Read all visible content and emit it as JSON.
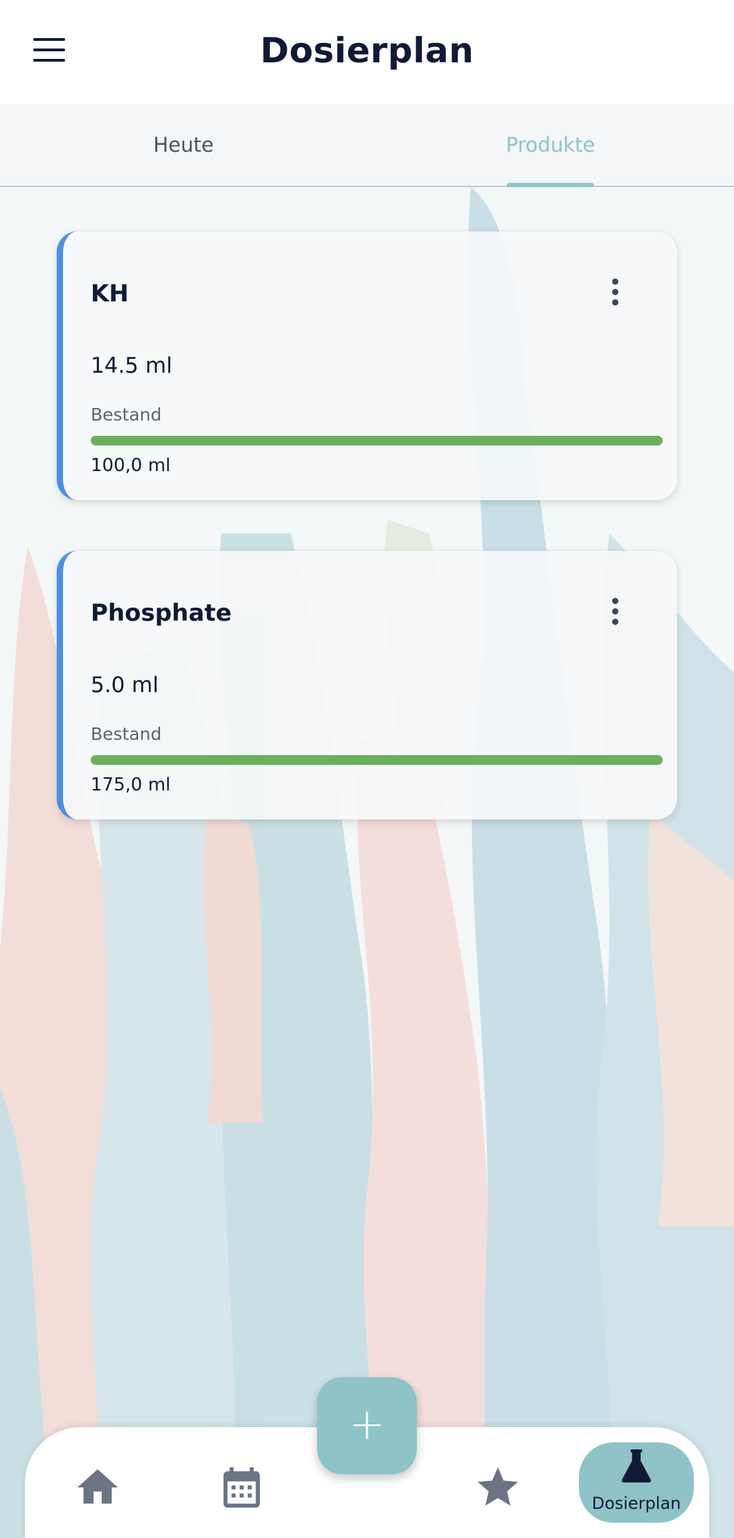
{
  "app_bar": {
    "title": "Dosierplan"
  },
  "tabs": [
    {
      "label": "Heute",
      "active": false
    },
    {
      "label": "Produkte",
      "active": true
    }
  ],
  "products": [
    {
      "name": "KH",
      "dose": "14.5 ml",
      "stock_label": "Bestand",
      "stock_amount": "100,0 ml",
      "stock_fraction": 1.0
    },
    {
      "name": "Phosphate",
      "dose": "5.0 ml",
      "stock_label": "Bestand",
      "stock_amount": "175,0 ml",
      "stock_fraction": 1.0
    }
  ],
  "fab": {
    "label": "+"
  },
  "bottom_nav": {
    "items": [
      {
        "icon": "home-icon",
        "label": ""
      },
      {
        "icon": "calendar-icon",
        "label": ""
      },
      {
        "icon": "star-icon",
        "label": ""
      },
      {
        "icon": "flask-icon",
        "label": "Dosierplan",
        "active": true
      }
    ]
  },
  "colors": {
    "primary_text": "#101a36",
    "accent": "#8ec3c7",
    "card_border": "#4a90e2",
    "stock_bar": "#6aaf5c"
  }
}
